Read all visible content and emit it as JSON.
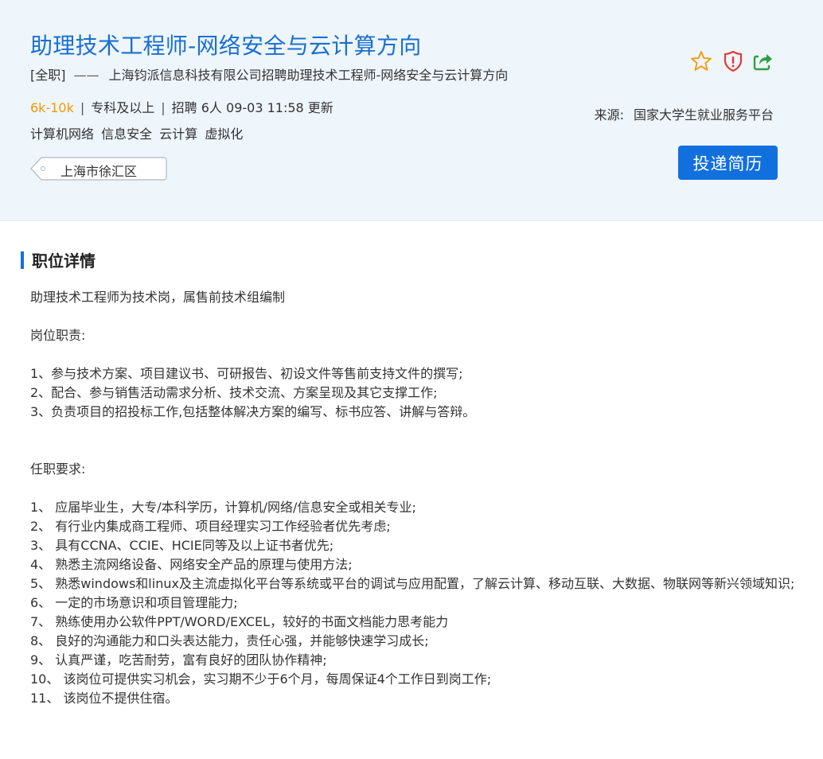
{
  "job": {
    "title": "助理技术工程师-网络安全与云计算方向",
    "type": "[全职]",
    "dash": "——",
    "company_line": "上海钧派信息科技有限公司招聘助理技术工程师-网络安全与云计算方向",
    "salary": "6k-10k",
    "separator": "|",
    "education": "专科及以上",
    "headcount": "招聘 6人",
    "updated": "09-03 11:58 更新",
    "tags": [
      "计算机网络",
      "信息安全",
      "云计算",
      "虚拟化"
    ],
    "location": "上海市徐汇区"
  },
  "source": {
    "label": "来源:",
    "value": "国家大学生就业服务平台"
  },
  "icons": {
    "favorite": "star-icon",
    "report": "shield-alert-icon",
    "share": "share-icon",
    "colors": {
      "star": "#f39800",
      "report": "#e53935",
      "share": "#2ea043"
    }
  },
  "apply_button": "投递简历",
  "section": {
    "title": "职位详情"
  },
  "detail": {
    "intro": "助理技术工程师为技术岗，属售前技术组编制",
    "duties_heading": "岗位职责:",
    "duties": [
      "1、参与技术方案、项目建议书、可研报告、初设文件等售前支持文件的撰写;",
      "2、配合、参与销售活动需求分析、技术交流、方案呈现及其它支撑工作;",
      "3、负责项目的招投标工作,包括整体解决方案的编写、标书应答、讲解与答辩。"
    ],
    "req_heading": "任职要求:",
    "requirements": [
      "1、 应届毕业生，大专/本科学历，计算机/网络/信息安全或相关专业;",
      "2、 有行业内集成商工程师、项目经理实习工作经验者优先考虑;",
      "3、 具有CCNA、CCIE、HCIE同等及以上证书者优先;",
      "4、 熟悉主流网络设备、网络安全产品的原理与使用方法;",
      "5、 熟悉windows和linux及主流虚拟化平台等系统或平台的调试与应用配置，了解云计算、移动互联、大数据、物联网等新兴领域知识;",
      "6、 一定的市场意识和项目管理能力;",
      "7、 熟练使用办公软件PPT/WORD/EXCEL，较好的书面文档能力思考能力",
      "8、 良好的沟通能力和口头表达能力，责任心强，并能够快速学习成长;",
      "9、 认真严谨，吃苦耐劳，富有良好的团队协作精神;",
      "10、 该岗位可提供实习机会，实习期不少于6个月，每周保证4个工作日到岗工作;",
      "11、 该岗位不提供住宿。"
    ]
  }
}
